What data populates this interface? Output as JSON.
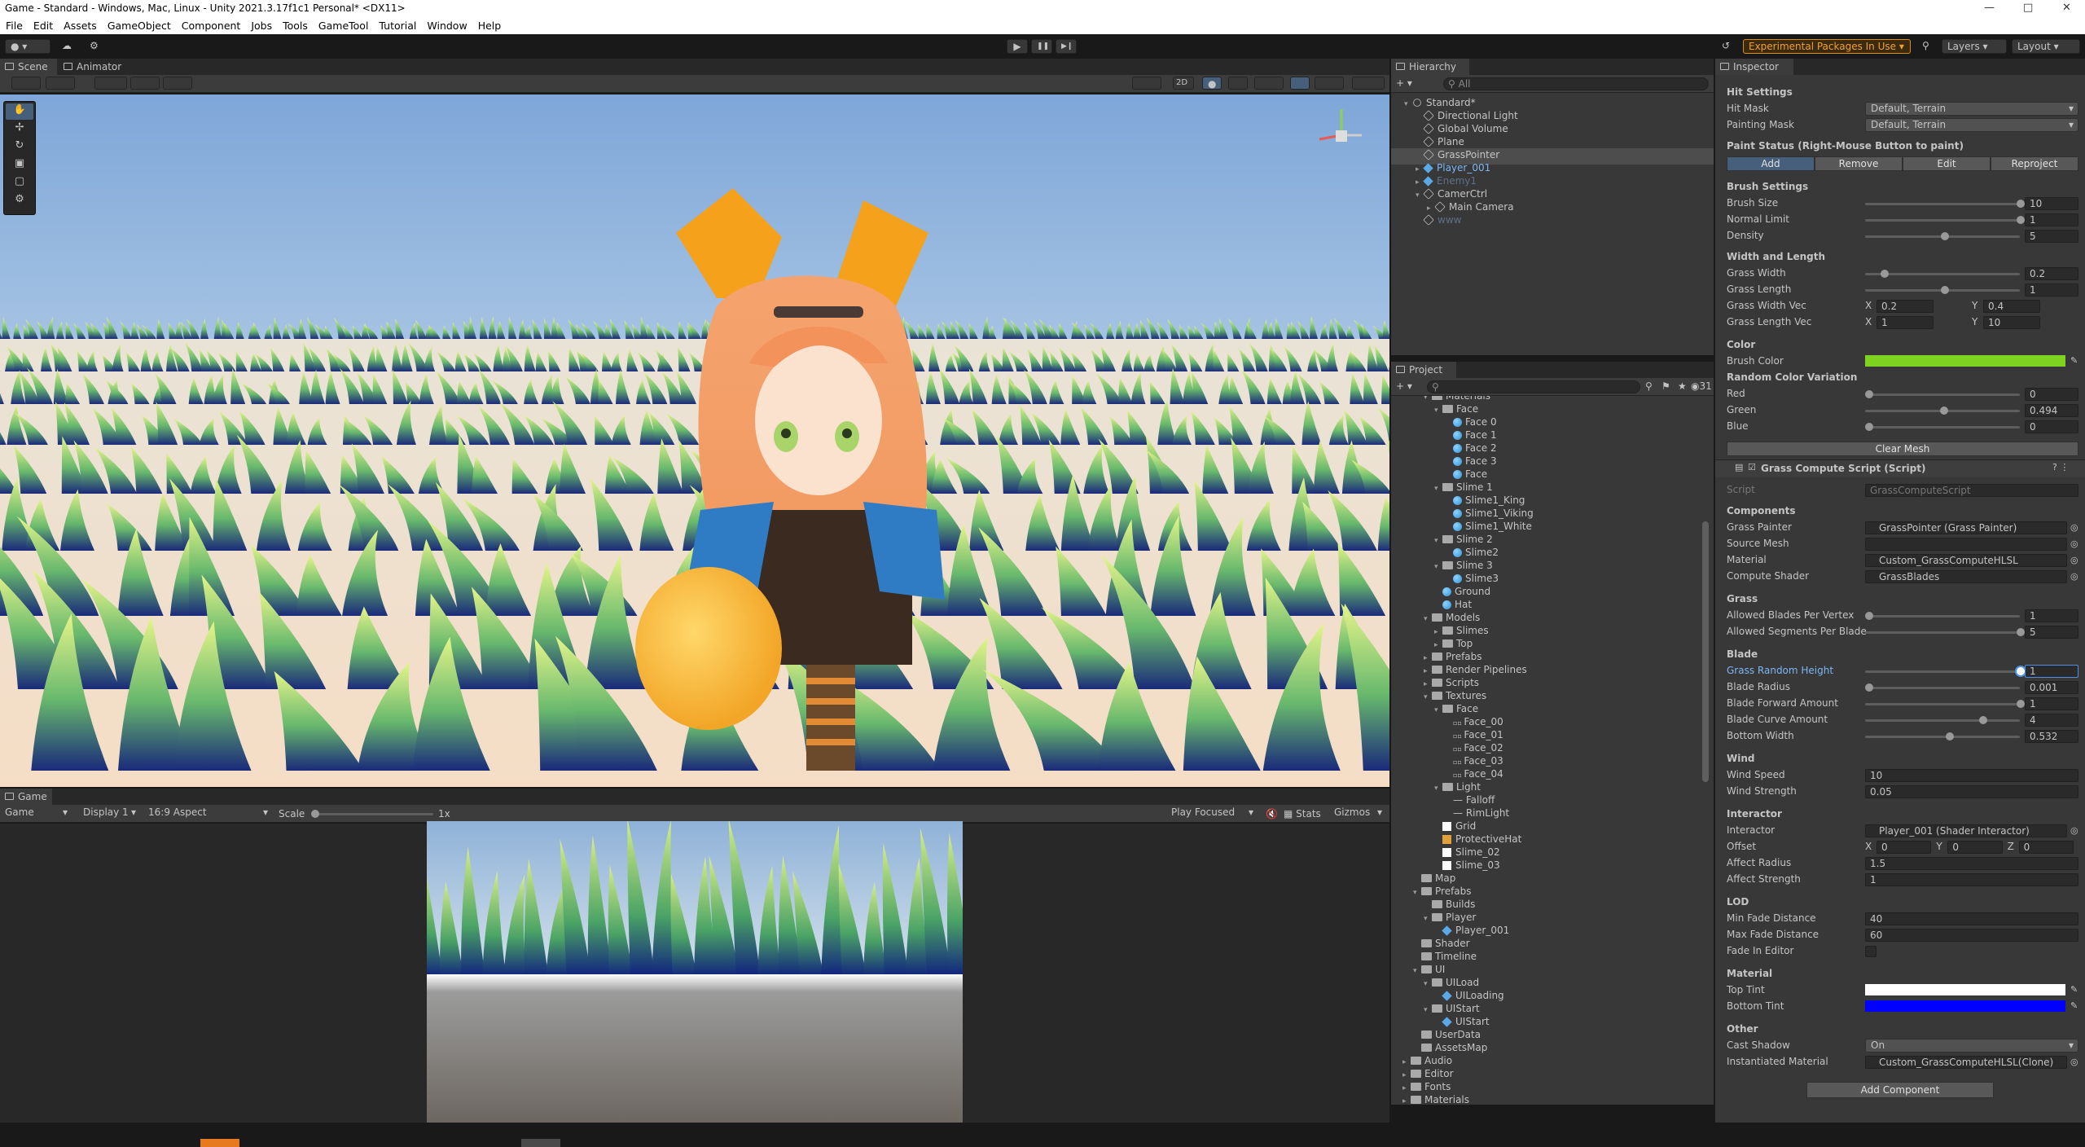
{
  "window": {
    "title": "Game - Standard - Windows, Mac, Linux - Unity 2021.3.17f1c1 Personal* <DX11>",
    "minimize": "—",
    "maximize": "□",
    "close": "✕"
  },
  "menu": [
    "File",
    "Edit",
    "Assets",
    "GameObject",
    "Component",
    "Jobs",
    "Tools",
    "GameTool",
    "Tutorial",
    "Window",
    "Help"
  ],
  "toolbar": {
    "play": "▶",
    "pause": "❚❚",
    "step": "▶❙",
    "experimental": "Experimental Packages In Use ▾",
    "layers": "Layers",
    "layout": "Layout",
    "search_icon": "search-icon",
    "history_icon": "history-icon",
    "cloud_icon": "cloud-icon",
    "account_icon": "account-icon"
  },
  "scene": {
    "tabs": [
      "Scene",
      "Animator"
    ],
    "mode2d": "2D"
  },
  "game": {
    "tab": "Game",
    "display_mode": "Game",
    "display": "Display 1",
    "aspect": "16:9 Aspect",
    "scale_label": "Scale",
    "scale_value": "1x",
    "play_focused": "Play Focused",
    "stats": "Stats",
    "gizmos": "Gizmos"
  },
  "hierarchy": {
    "tab": "Hierarchy",
    "search_placeholder": "All",
    "items": [
      {
        "label": "Standard*",
        "depth": 0,
        "icon": "unity",
        "arrow": "▾"
      },
      {
        "label": "Directional Light",
        "depth": 1,
        "icon": "go"
      },
      {
        "label": "Global Volume",
        "depth": 1,
        "icon": "go"
      },
      {
        "label": "Plane",
        "depth": 1,
        "icon": "go"
      },
      {
        "label": "GrassPointer",
        "depth": 1,
        "icon": "go",
        "selected": true
      },
      {
        "label": "Player_001",
        "depth": 1,
        "icon": "prefab",
        "arrow": "▸",
        "blue": true
      },
      {
        "label": "Enemy1",
        "depth": 1,
        "icon": "prefab",
        "arrow": "▸",
        "dim": true
      },
      {
        "label": "CamerCtrl",
        "depth": 1,
        "icon": "go",
        "arrow": "▾"
      },
      {
        "label": "Main Camera",
        "depth": 2,
        "icon": "go",
        "arrow": "▸"
      },
      {
        "label": "www",
        "depth": 1,
        "icon": "go",
        "dim": true
      }
    ]
  },
  "project": {
    "tab": "Project",
    "count": "31",
    "items": [
      {
        "label": "Materials",
        "depth": 2,
        "icon": "folder",
        "arrow": "▾"
      },
      {
        "label": "Face",
        "depth": 3,
        "icon": "folder",
        "arrow": "▾"
      },
      {
        "label": "Face 0",
        "depth": 4,
        "icon": "mat"
      },
      {
        "label": "Face 1",
        "depth": 4,
        "icon": "mat"
      },
      {
        "label": "Face 2",
        "depth": 4,
        "icon": "mat"
      },
      {
        "label": "Face 3",
        "depth": 4,
        "icon": "mat"
      },
      {
        "label": "Face",
        "depth": 4,
        "icon": "mat"
      },
      {
        "label": "Slime 1",
        "depth": 3,
        "icon": "folder",
        "arrow": "▾"
      },
      {
        "label": "Slime1_King",
        "depth": 4,
        "icon": "mat"
      },
      {
        "label": "Slime1_Viking",
        "depth": 4,
        "icon": "mat"
      },
      {
        "label": "Slime1_White",
        "depth": 4,
        "icon": "mat"
      },
      {
        "label": "Slime 2",
        "depth": 3,
        "icon": "folder",
        "arrow": "▾"
      },
      {
        "label": "Slime2",
        "depth": 4,
        "icon": "mat"
      },
      {
        "label": "Slime 3",
        "depth": 3,
        "icon": "folder",
        "arrow": "▾"
      },
      {
        "label": "Slime3",
        "depth": 4,
        "icon": "mat"
      },
      {
        "label": "Ground",
        "depth": 3,
        "icon": "mat"
      },
      {
        "label": "Hat",
        "depth": 3,
        "icon": "mat"
      },
      {
        "label": "Models",
        "depth": 2,
        "icon": "folder",
        "arrow": "▾"
      },
      {
        "label": "Slimes",
        "depth": 3,
        "icon": "folder",
        "arrow": "▸"
      },
      {
        "label": "Top",
        "depth": 3,
        "icon": "folder",
        "arrow": "▸"
      },
      {
        "label": "Prefabs",
        "depth": 2,
        "icon": "folder",
        "arrow": "▸"
      },
      {
        "label": "Render Pipelines",
        "depth": 2,
        "icon": "folder",
        "arrow": "▸"
      },
      {
        "label": "Scripts",
        "depth": 2,
        "icon": "folder",
        "arrow": "▸"
      },
      {
        "label": "Textures",
        "depth": 2,
        "icon": "folder",
        "arrow": "▾"
      },
      {
        "label": "Face",
        "depth": 3,
        "icon": "folder",
        "arrow": "▾"
      },
      {
        "label": "Face_00",
        "depth": 4,
        "icon": "tex"
      },
      {
        "label": "Face_01",
        "depth": 4,
        "icon": "tex"
      },
      {
        "label": "Face_02",
        "depth": 4,
        "icon": "tex"
      },
      {
        "label": "Face_03",
        "depth": 4,
        "icon": "tex"
      },
      {
        "label": "Face_04",
        "depth": 4,
        "icon": "tex"
      },
      {
        "label": "Light",
        "depth": 3,
        "icon": "folder",
        "arrow": "▾"
      },
      {
        "label": "Falloff",
        "depth": 4,
        "icon": "line"
      },
      {
        "label": "RimLight",
        "depth": 4,
        "icon": "line"
      },
      {
        "label": "Grid",
        "depth": 3,
        "icon": "white"
      },
      {
        "label": "ProtectiveHat",
        "depth": 3,
        "icon": "hat"
      },
      {
        "label": "Slime_02",
        "depth": 3,
        "icon": "white"
      },
      {
        "label": "Slime_03",
        "depth": 3,
        "icon": "white"
      },
      {
        "label": "Map",
        "depth": 1,
        "icon": "folder"
      },
      {
        "label": "Prefabs",
        "depth": 1,
        "icon": "folder",
        "arrow": "▾"
      },
      {
        "label": "Builds",
        "depth": 2,
        "icon": "folder"
      },
      {
        "label": "Player",
        "depth": 2,
        "icon": "folder",
        "arrow": "▾"
      },
      {
        "label": "Player_001",
        "depth": 3,
        "icon": "prefab"
      },
      {
        "label": "Shader",
        "depth": 1,
        "icon": "folder"
      },
      {
        "label": "Timeline",
        "depth": 1,
        "icon": "folder"
      },
      {
        "label": "UI",
        "depth": 1,
        "icon": "folder",
        "arrow": "▾"
      },
      {
        "label": "UILoad",
        "depth": 2,
        "icon": "folder",
        "arrow": "▾"
      },
      {
        "label": "UILoading",
        "depth": 3,
        "icon": "prefab"
      },
      {
        "label": "UIStart",
        "depth": 2,
        "icon": "folder",
        "arrow": "▾"
      },
      {
        "label": "UIStart",
        "depth": 3,
        "icon": "prefab"
      },
      {
        "label": "UserData",
        "depth": 1,
        "icon": "folder"
      },
      {
        "label": "AssetsMap",
        "depth": 1,
        "icon": "folder"
      },
      {
        "label": "Audio",
        "depth": 0,
        "icon": "folder",
        "arrow": "▸"
      },
      {
        "label": "Editor",
        "depth": 0,
        "icon": "folder",
        "arrow": "▸"
      },
      {
        "label": "Fonts",
        "depth": 0,
        "icon": "folder",
        "arrow": "▸"
      },
      {
        "label": "Materials",
        "depth": 0,
        "icon": "folder",
        "arrow": "▸"
      }
    ]
  },
  "inspector": {
    "tab": "Inspector",
    "hit_settings": {
      "header": "Hit Settings",
      "hit_mask_label": "Hit Mask",
      "hit_mask": "Default, Terrain",
      "painting_mask_label": "Painting Mask",
      "painting_mask": "Default, Terrain"
    },
    "paint_status": {
      "header": "Paint Status (Right-Mouse Button to paint)",
      "buttons": [
        "Add",
        "Remove",
        "Edit",
        "Reproject"
      ]
    },
    "brush": {
      "header": "Brush Settings",
      "rows": [
        {
          "label": "Brush Size",
          "value": "10",
          "fraction": 1.0
        },
        {
          "label": "Normal Limit",
          "value": "1",
          "fraction": 1.0
        },
        {
          "label": "Density",
          "value": "5",
          "fraction": 0.5
        }
      ]
    },
    "width_length": {
      "header": "Width and Length",
      "rows": [
        {
          "label": "Grass Width",
          "value": "0.2",
          "fraction": 0.1
        },
        {
          "label": "Grass Length",
          "value": "1",
          "fraction": 0.5
        }
      ],
      "width_vec_label": "Grass Width Vec",
      "width_vec": {
        "x": "0.2",
        "y": "0.4"
      },
      "length_vec_label": "Grass Length Vec",
      "length_vec": {
        "x": "1",
        "y": "10"
      }
    },
    "color": {
      "header": "Color",
      "brush_color_label": "Brush Color",
      "brush_color": "#7ed321"
    },
    "random": {
      "header": "Random Color Variation",
      "rows": [
        {
          "label": "Red",
          "value": "0",
          "fraction": 0.0
        },
        {
          "label": "Green",
          "value": "0.494",
          "fraction": 0.494
        },
        {
          "label": "Blue",
          "value": "0",
          "fraction": 0.0
        }
      ]
    },
    "clear_mesh": "Clear Mesh",
    "component": {
      "title": "Grass Compute Script (Script)",
      "script_label": "Script",
      "script_value": "GrassComputeScript"
    },
    "components": {
      "header": "Components",
      "rows": [
        {
          "label": "Grass Painter",
          "value": "GrassPointer (Grass Painter)"
        },
        {
          "label": "Source Mesh",
          "value": ""
        },
        {
          "label": "Material",
          "value": "Custom_GrassComputeHLSL"
        },
        {
          "label": "Compute Shader",
          "value": "GrassBlades"
        }
      ]
    },
    "grass": {
      "header": "Grass",
      "rows": [
        {
          "label": "Allowed Blades Per Vertex",
          "value": "1",
          "fraction": 0.0
        },
        {
          "label": "Allowed Segments Per Blade",
          "value": "5",
          "fraction": 1.0
        }
      ]
    },
    "blade": {
      "header": "Blade",
      "rows": [
        {
          "label": "Grass Random Height",
          "value": "1",
          "fraction": 1.0,
          "active": true
        },
        {
          "label": "Blade Radius",
          "value": "0.001",
          "fraction": 0.0
        },
        {
          "label": "Blade Forward Amount",
          "value": "1",
          "fraction": 1.0
        },
        {
          "label": "Blade Curve Amount",
          "value": "4",
          "fraction": 0.75
        },
        {
          "label": "Bottom Width",
          "value": "0.532",
          "fraction": 0.53
        }
      ]
    },
    "wind": {
      "header": "Wind",
      "rows": [
        {
          "label": "Wind Speed",
          "value": "10"
        },
        {
          "label": "Wind Strength",
          "value": "0.05"
        }
      ]
    },
    "interactor": {
      "header": "Interactor",
      "interactor_label": "Interactor",
      "interactor_value": "Player_001 (Shader Interactor)",
      "offset_label": "Offset",
      "offset": {
        "x": "0",
        "y": "0",
        "z": "0"
      },
      "rows": [
        {
          "label": "Affect Radius",
          "value": "1.5"
        },
        {
          "label": "Affect Strength",
          "value": "1"
        }
      ]
    },
    "lod": {
      "header": "LOD",
      "rows": [
        {
          "label": "Min Fade Distance",
          "value": "40"
        },
        {
          "label": "Max Fade Distance",
          "value": "60"
        }
      ],
      "fade_label": "Fade In Editor"
    },
    "material": {
      "header": "Material",
      "top_tint_label": "Top Tint",
      "top_tint": "#ffffff",
      "bottom_tint_label": "Bottom Tint",
      "bottom_tint": "#0000ff"
    },
    "other": {
      "header": "Other",
      "cast_shadow_label": "Cast Shadow",
      "cast_shadow": "On",
      "instantiated_label": "Instantiated Material",
      "instantiated_value": "Custom_GrassComputeHLSL(Clone)"
    },
    "add_component": "Add Component"
  }
}
